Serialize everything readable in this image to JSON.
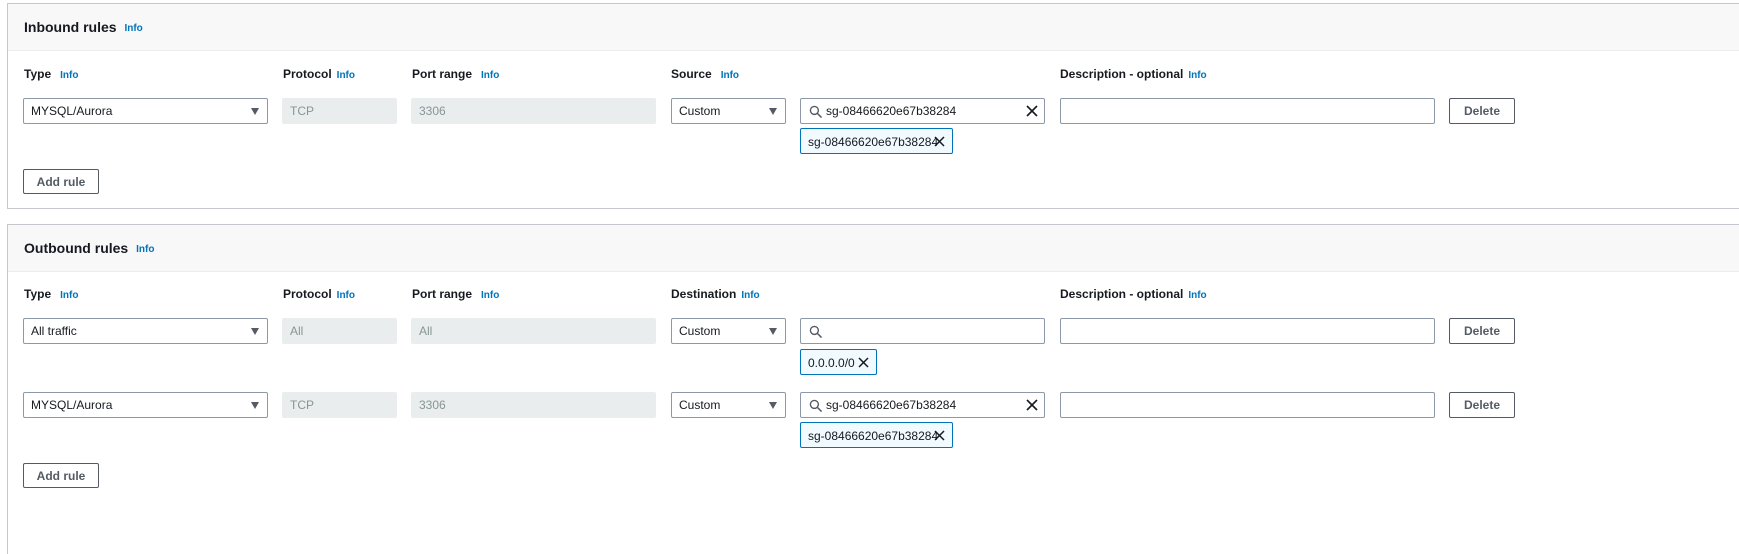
{
  "inbound": {
    "title": "Inbound rules",
    "title_info": "Info",
    "columns": {
      "type": "Type",
      "type_info": "Info",
      "protocol": "Protocol",
      "protocol_info": "Info",
      "port_range": "Port range",
      "port_range_info": "Info",
      "source": "Source",
      "source_info": "Info",
      "description": "Description - optional",
      "description_info": "Info"
    },
    "rules": [
      {
        "type": "MYSQL/Aurora",
        "protocol": "TCP",
        "port_range": "3306",
        "source_type": "Custom",
        "search_value": "sg-08466620e67b38284",
        "token": "sg-08466620e67b38284",
        "delete_label": "Delete"
      }
    ],
    "add_rule_label": "Add rule"
  },
  "outbound": {
    "title": "Outbound rules",
    "title_info": "Info",
    "columns": {
      "type": "Type",
      "type_info": "Info",
      "protocol": "Protocol",
      "protocol_info": "Info",
      "port_range": "Port range",
      "port_range_info": "Info",
      "destination": "Destination",
      "destination_info": "Info",
      "description": "Description - optional",
      "description_info": "Info"
    },
    "rules": [
      {
        "type": "All traffic",
        "protocol": "All",
        "port_range": "All",
        "dest_type": "Custom",
        "search_value": "",
        "token": "0.0.0.0/0",
        "delete_label": "Delete"
      },
      {
        "type": "MYSQL/Aurora",
        "protocol": "TCP",
        "port_range": "3306",
        "dest_type": "Custom",
        "search_value": "sg-08466620e67b38284",
        "token": "sg-08466620e67b38284",
        "delete_label": "Delete"
      }
    ],
    "add_rule_label": "Add rule"
  },
  "colors": {
    "info_link": "#0073bb",
    "token_border": "#0073bb",
    "token_bg": "#f1faff",
    "disabled_bg": "#eaeded",
    "header_bg": "#f8f8f8"
  }
}
